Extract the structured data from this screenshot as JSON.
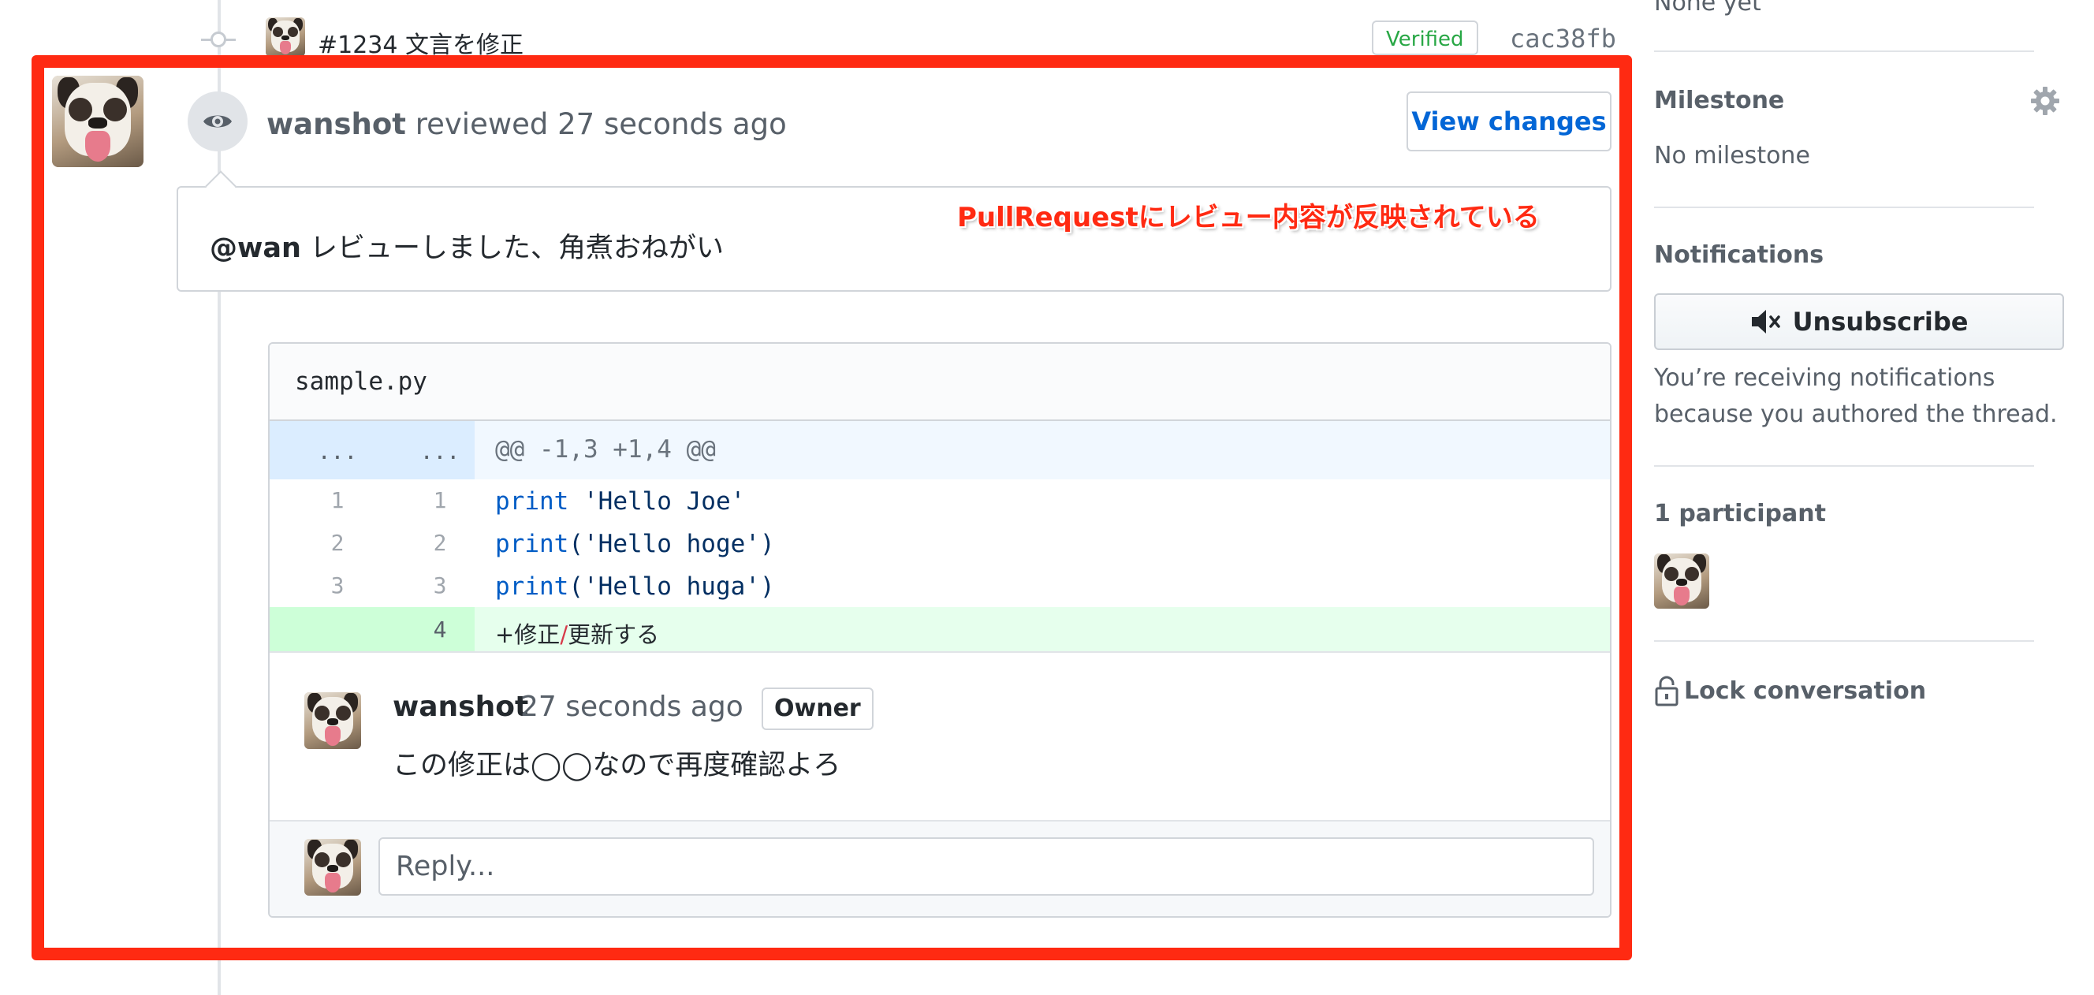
{
  "commit": {
    "message": "#1234  文言を修正",
    "verified_label": "Verified",
    "sha": "cac38fb"
  },
  "review": {
    "author": "wanshot",
    "action_time": "reviewed 27 seconds ago",
    "view_changes_label": "View changes",
    "mention": "@wan",
    "body": " レビューしました、角煮おねがい",
    "annotation": "PullRequestにレビュー内容が反映されている"
  },
  "diff": {
    "file_name": "sample.py",
    "hunk": {
      "old": "...",
      "new": "...",
      "text": "@@ -1,3 +1,4 @@"
    },
    "lines": [
      {
        "old": "1",
        "new": "1",
        "kw": "print",
        "rest": " 'Hello Joe'"
      },
      {
        "old": "2",
        "new": "2",
        "kw": "print",
        "rest": "('Hello hoge')"
      },
      {
        "old": "3",
        "new": "3",
        "kw": "print",
        "rest": "('Hello huga')"
      }
    ],
    "added": {
      "new": "4",
      "part1": "+修正",
      "slash": "/",
      "part2": "更新する"
    }
  },
  "inline_comment": {
    "author": "wanshot",
    "time": "27 seconds ago",
    "badge": "Owner",
    "body": "この修正は◯◯なので再度確認よろ",
    "reply_placeholder": "Reply..."
  },
  "sidebar": {
    "reviewers_value": "None yet",
    "milestone_title": "Milestone",
    "milestone_value": "No milestone",
    "notifications_title": "Notifications",
    "unsubscribe_label": "Unsubscribe",
    "notifications_reason_1": "You’re receiving notifications",
    "notifications_reason_2": "because you authored the thread.",
    "participants_title": "1 participant",
    "lock_label": "Lock conversation"
  },
  "colors": {
    "annotation_red": "#ff2a12",
    "link_blue": "#0366d6",
    "verified_green": "#28a745",
    "added_bg": "#e6ffed",
    "hunk_bg": "#f1f8ff"
  },
  "icons": [
    "commit-dot-icon",
    "eye-icon",
    "gear-icon",
    "mute-icon",
    "lock-icon"
  ]
}
